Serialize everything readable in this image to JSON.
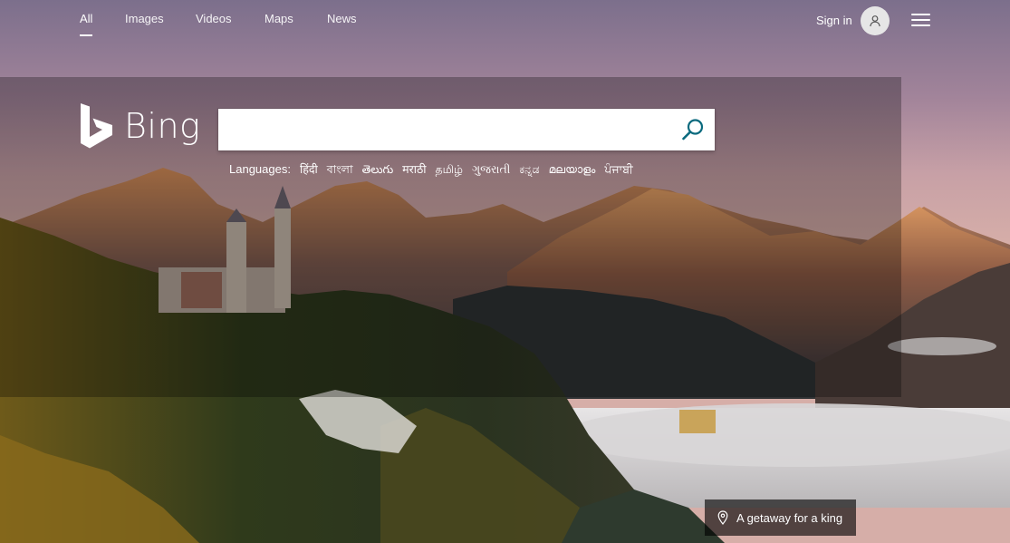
{
  "topnav": {
    "items": [
      {
        "label": "All",
        "active": true
      },
      {
        "label": "Images"
      },
      {
        "label": "Videos"
      },
      {
        "label": "Maps"
      },
      {
        "label": "News"
      }
    ],
    "signin_label": "Sign in",
    "avatar_icon": "user-icon",
    "menu_icon": "hamburger-menu-icon"
  },
  "logo": {
    "text": "Bing",
    "icon": "bing-b-logo-icon"
  },
  "search": {
    "value": "",
    "placeholder": "",
    "button_icon": "search-icon",
    "accent": "#0a6a7e"
  },
  "languages": {
    "label": "Languages:",
    "items": [
      "हिंदी",
      "বাংলা",
      "తెలుగు",
      "मराठी",
      "தமிழ்",
      "ગુજરાતી",
      "ಕನ್ನಡ",
      "മലയാളം",
      "ਪੰਜਾਬੀ"
    ]
  },
  "caption": {
    "text": "A getaway for a king",
    "icon": "location-pin-icon"
  }
}
